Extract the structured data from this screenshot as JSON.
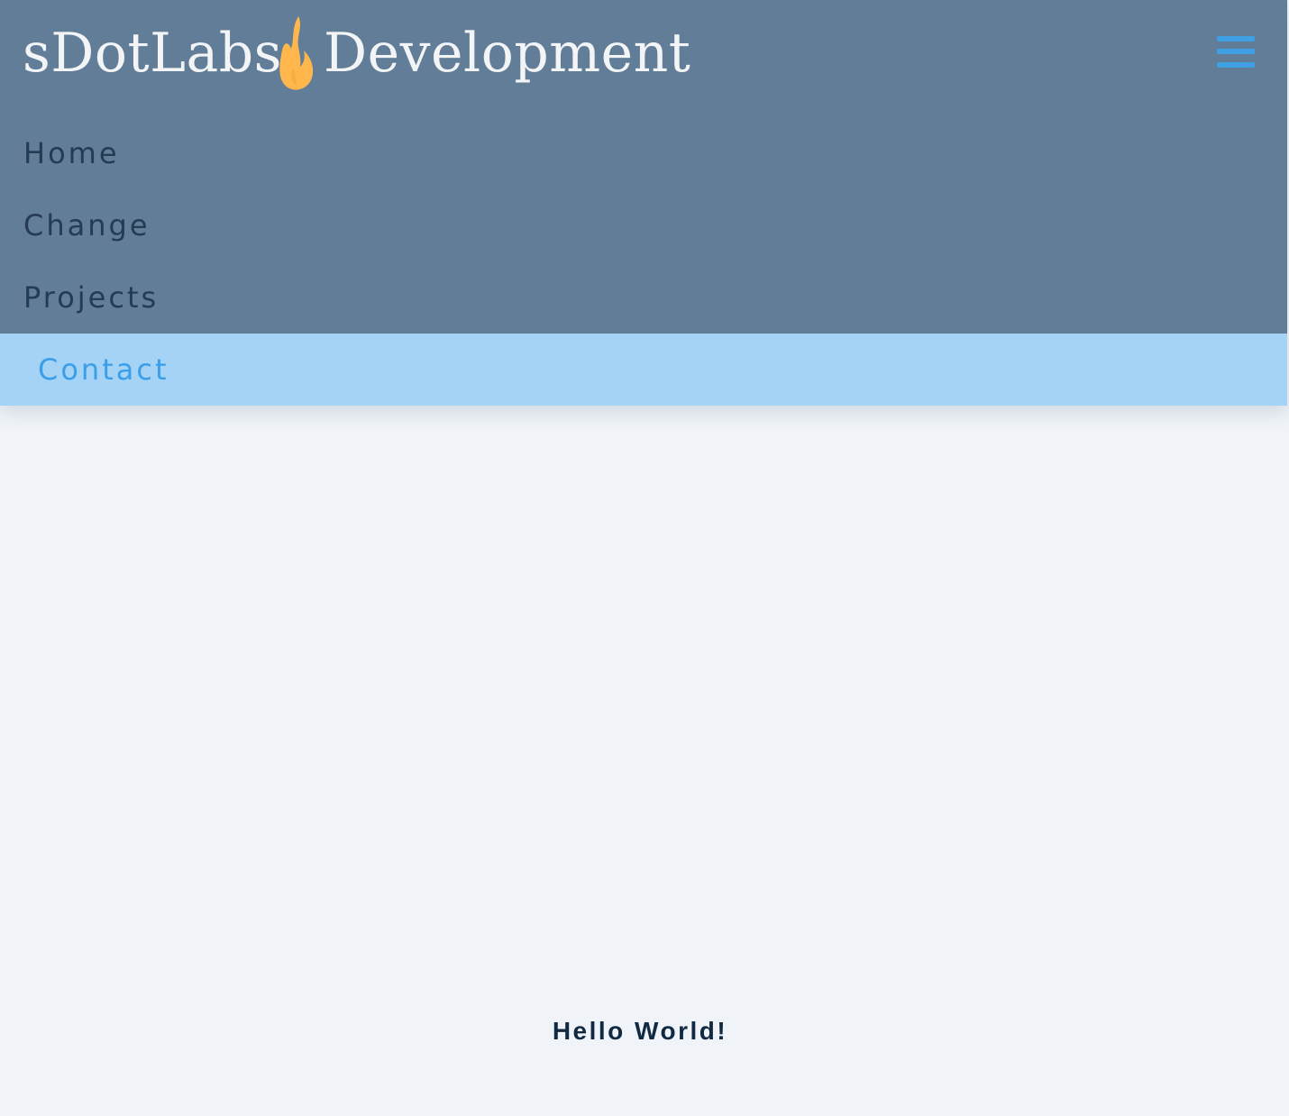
{
  "header": {
    "logo_text_left": "sDotLabs",
    "logo_text_right": "Development",
    "logo_icon": "flame-icon",
    "menu_icon": "hamburger-menu-icon"
  },
  "nav": {
    "items": [
      {
        "label": "Home",
        "active": false
      },
      {
        "label": "Change",
        "active": false
      },
      {
        "label": "Projects",
        "active": false
      },
      {
        "label": "Contact",
        "active": true
      }
    ]
  },
  "main": {
    "greeting": "Hello World!"
  },
  "colors": {
    "header_bg": "#627d98",
    "page_bg": "#f0f4f8",
    "active_item_bg": "#a4d3f5",
    "accent_blue": "#3ea0e3",
    "nav_text": "#243b53",
    "flame": "#ffb74d",
    "greeting_text": "#102a43"
  }
}
